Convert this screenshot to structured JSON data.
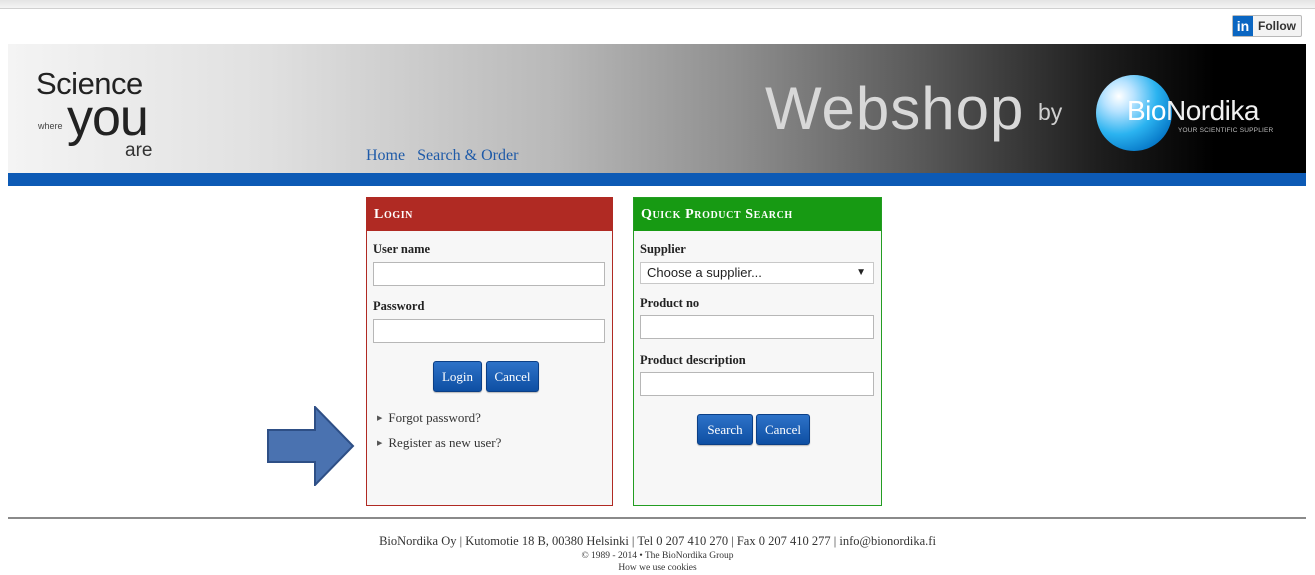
{
  "social": {
    "icon_text": "in",
    "follow_label": "Follow"
  },
  "banner": {
    "tagline_science": "Science",
    "tagline_where": "where",
    "tagline_you": "you",
    "tagline_are": "are",
    "webshop_title": "Webshop",
    "by": "by",
    "brand_bio": "Bio",
    "brand_nordika": "Nordika",
    "brand_tagline": "YOUR SCIENTIFIC SUPPLIER"
  },
  "nav": {
    "items": [
      "Home",
      "Search & Order"
    ]
  },
  "login": {
    "title": "Login",
    "username_label": "User name",
    "username_value": "",
    "password_label": "Password",
    "password_value": "",
    "login_button": "Login",
    "cancel_button": "Cancel",
    "links": [
      "Forgot password?",
      "Register as new user?"
    ]
  },
  "search": {
    "title": "Quick Product Search",
    "supplier_label": "Supplier",
    "supplier_selected": "Choose a supplier...",
    "product_no_label": "Product no",
    "product_no_value": "",
    "description_label": "Product description",
    "description_value": "",
    "search_button": "Search",
    "cancel_button": "Cancel"
  },
  "footer": {
    "line1": "BioNordika Oy | Kutomotie 18 B, 00380 Helsinki | Tel 0 207 410 270 | Fax 0 207 410 277 | info@bionordika.fi",
    "line2": "© 1989 - 2014 • The BioNordika Group",
    "line3": "How we use cookies"
  },
  "colors": {
    "login_header": "#b02a23",
    "search_header": "#179a13",
    "accent_blue": "#0d5ab5",
    "annotation_arrow": "#4a72b0"
  },
  "annotation": {
    "icon": "right-arrow-icon"
  }
}
